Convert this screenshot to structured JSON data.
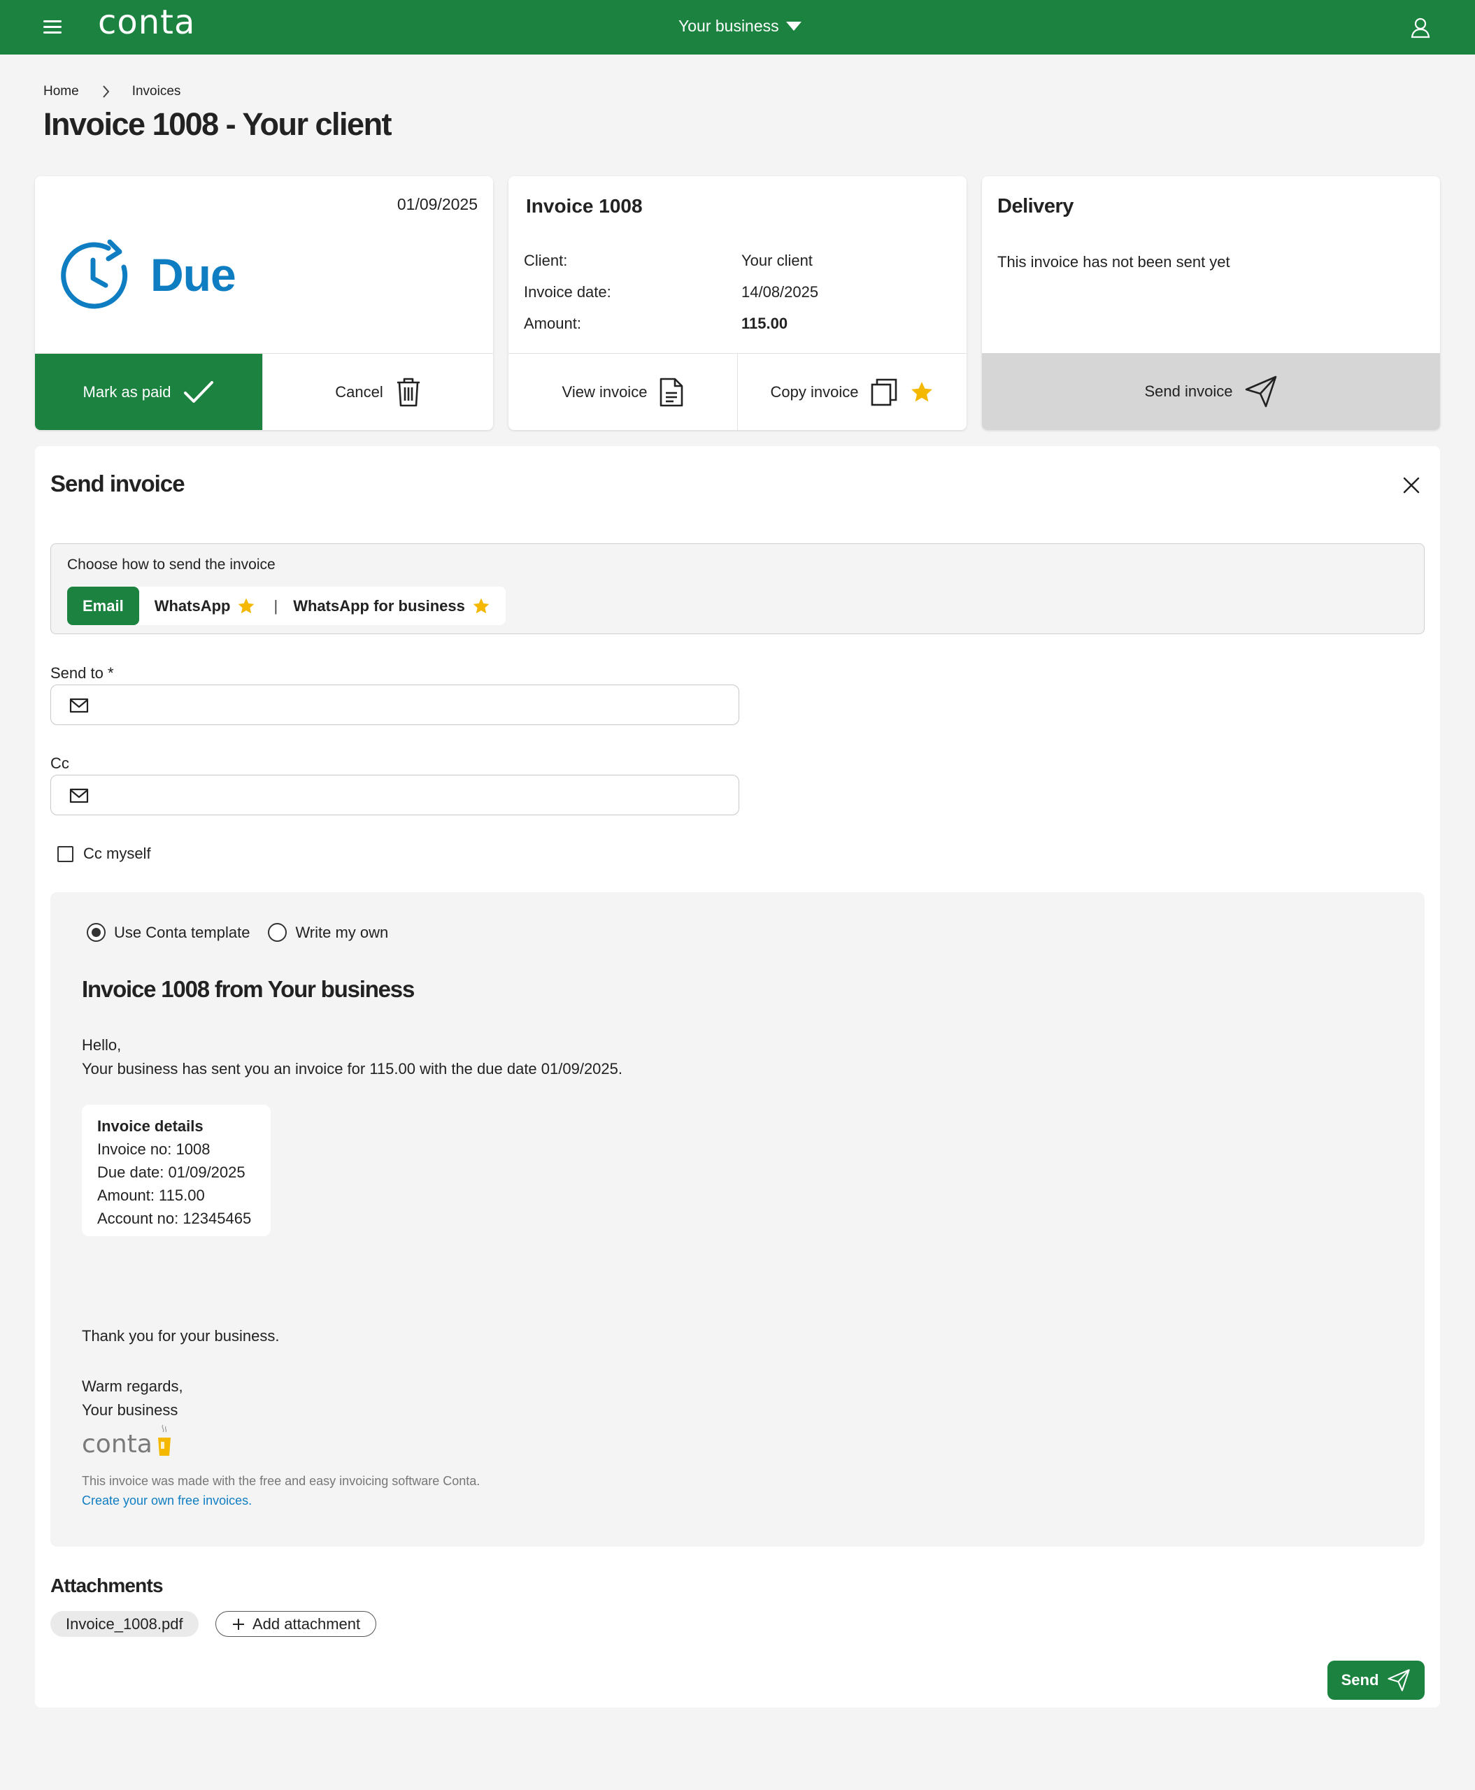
{
  "header": {
    "logo": "conta",
    "business_selector": "Your business",
    "colors": {
      "brand": "#1b8240",
      "accent_blue": "#0f7dc2",
      "star": "#f5b800"
    },
    "icons": [
      "menu-icon",
      "chevron-down-icon",
      "user-icon"
    ]
  },
  "breadcrumb": {
    "home": "Home",
    "current": "Invoices"
  },
  "page_title": "Invoice 1008 - Your client",
  "status_card": {
    "date": "01/09/2025",
    "status": "Due",
    "mark_paid_label": "Mark as paid",
    "cancel_label": "Cancel"
  },
  "invoice_card": {
    "heading": "Invoice 1008",
    "client_label": "Client:",
    "client_value": "Your client",
    "date_label": "Invoice date:",
    "date_value": "14/08/2025",
    "amount_label": "Amount:",
    "amount_value": "115.00",
    "view_label": "View invoice",
    "copy_label": "Copy invoice"
  },
  "delivery_card": {
    "heading": "Delivery",
    "text": "This invoice has not been sent yet",
    "send_label": "Send invoice"
  },
  "send_panel": {
    "title": "Send invoice",
    "method_label": "Choose how to send the invoice",
    "methods": [
      "Email",
      "WhatsApp",
      "WhatsApp for business"
    ],
    "separator": "|",
    "send_to_label": "Send to",
    "required_mark": "*",
    "send_to_value": "",
    "cc_label": "Cc",
    "cc_value": "",
    "cc_myself_label": "Cc myself",
    "template_options": [
      "Use Conta template",
      "Write my own"
    ],
    "selected_template": "Use Conta template",
    "subject": "Invoice 1008 from Your business",
    "greeting": "Hello,",
    "intro": "Your business has sent you an invoice for 115.00 with the due date 01/09/2025.",
    "details_title": "Invoice details",
    "details": [
      "Invoice no: 1008",
      "Due date: 01/09/2025",
      "Amount: 115.00",
      "Account no: 12345465"
    ],
    "thanks": "Thank you for your business.",
    "regards": "Warm regards,",
    "signature": "Your business",
    "footer_logo": "conta",
    "footer_text": "This invoice was made with the free and easy invoicing software Conta.",
    "footer_link": "Create your own free invoices.",
    "attachments_title": "Attachments",
    "attachment_file": "Invoice_1008.pdf",
    "add_attachment_label": "Add attachment",
    "send_button": "Send"
  }
}
